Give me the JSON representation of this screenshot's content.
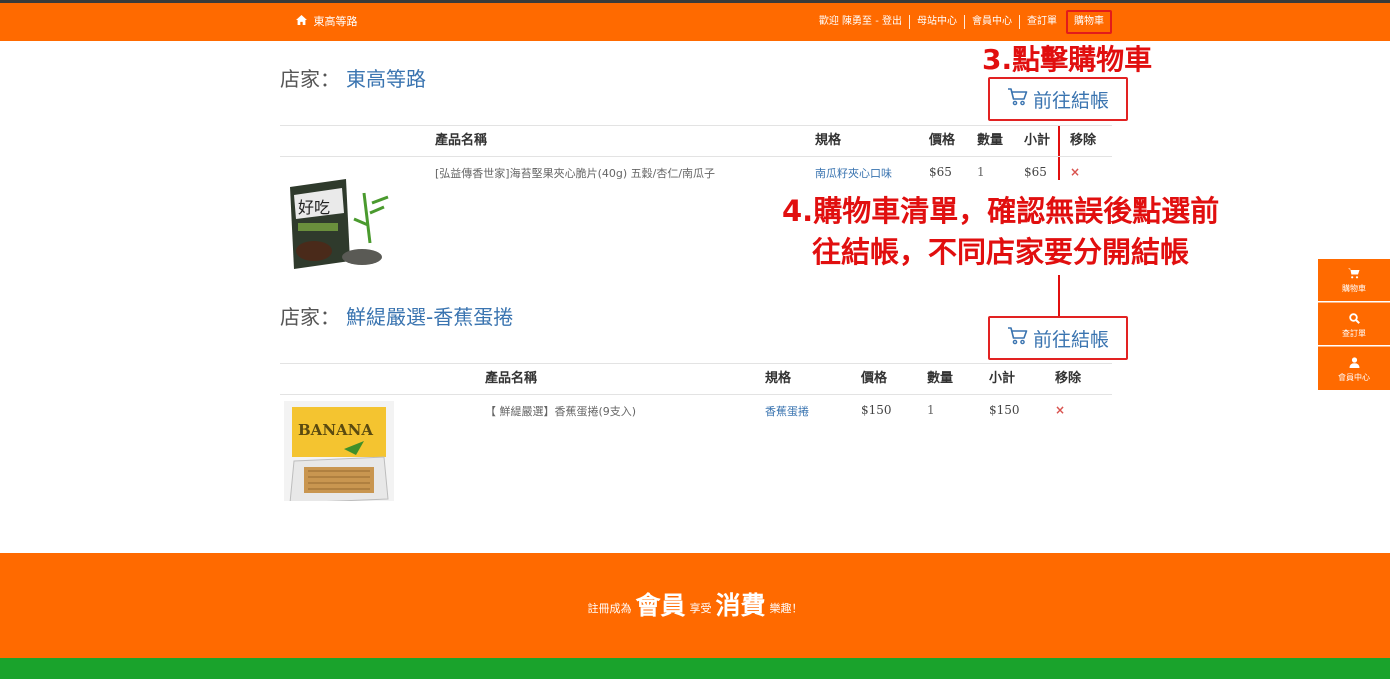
{
  "nav": {
    "brand": "東高等路",
    "links": [
      {
        "label": "歡迎 陳勇至 - 登出"
      },
      {
        "label": "母站中心"
      },
      {
        "label": "會員中心"
      },
      {
        "label": "查訂單"
      },
      {
        "label": "購物車"
      }
    ]
  },
  "headers": [
    "產品名稱",
    "規格",
    "價格",
    "數量",
    "小計",
    "移除"
  ],
  "stores": [
    {
      "label": "店家：",
      "name": "東高等路",
      "checkout_label": "前往結帳",
      "items": [
        {
          "name": "[弘益傳香世家]海苔堅果夾心脆片(40g) 五穀/杏仁/南瓜子",
          "spec": "南瓜籽夾心口味",
          "price": "$65",
          "qty": "1",
          "subtotal": "$65",
          "remove": "×"
        }
      ]
    },
    {
      "label": "店家：",
      "name": "鮮緹嚴選-香蕉蛋捲",
      "checkout_label": "前往結帳",
      "items": [
        {
          "name": "【 鮮緹嚴選】香蕉蛋捲(9支入)",
          "spec": "香蕉蛋捲",
          "price": "$150",
          "qty": "1",
          "subtotal": "$150",
          "remove": "×"
        }
      ]
    }
  ],
  "annotations": {
    "step3": "3.點擊購物車",
    "step4_line1": "4.購物車清單，確認無誤後點選前",
    "step4_line2": "往結帳，不同店家要分開結帳"
  },
  "sidebar": [
    {
      "label": "購物車",
      "icon": "cart-icon"
    },
    {
      "label": "查訂單",
      "icon": "search-icon"
    },
    {
      "label": "會員中心",
      "icon": "user-icon"
    }
  ],
  "footer": {
    "pre": "註冊成為",
    "big1": "會員",
    "mid": "享受",
    "big2": "消費",
    "post": "樂趣！"
  },
  "colors": {
    "brand_orange": "#ff6a00",
    "accent_blue": "#3a74b0",
    "annotation_red": "#e10f0f",
    "footer_green": "#1aa32c"
  }
}
